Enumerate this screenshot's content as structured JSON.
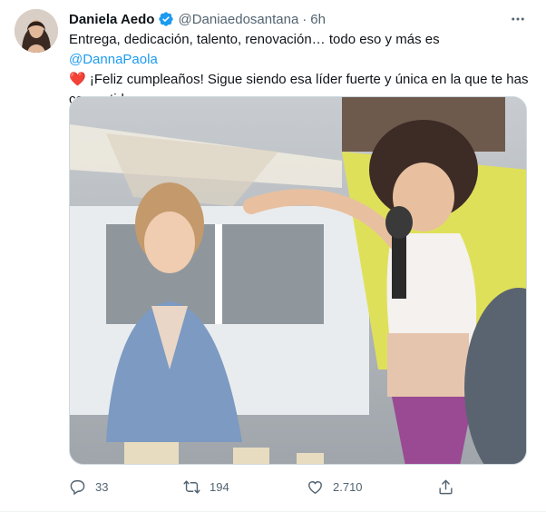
{
  "tweet": {
    "author": {
      "display_name": "Daniela Aedo",
      "handle": "@Daniaedosantana",
      "verified_icon": "verified-badge-icon"
    },
    "separator": "·",
    "time": "6h",
    "text": {
      "line1": "Entrega, dedicación, talento, renovación… todo eso y más es ",
      "mention": "@DannaPaola",
      "heart": "❤️",
      "line2": " ¡Feliz cumpleaños! Sigue siendo esa líder fuerte y única en la que te has convertido"
    },
    "media": {
      "description_icon": "photo-image"
    },
    "actions": {
      "replies": "33",
      "retweets": "194",
      "likes": "2.710"
    }
  },
  "colors": {
    "accent": "#1d9bf0",
    "muted": "#536471",
    "heart": "#e0245e",
    "text": "#0f1419"
  }
}
